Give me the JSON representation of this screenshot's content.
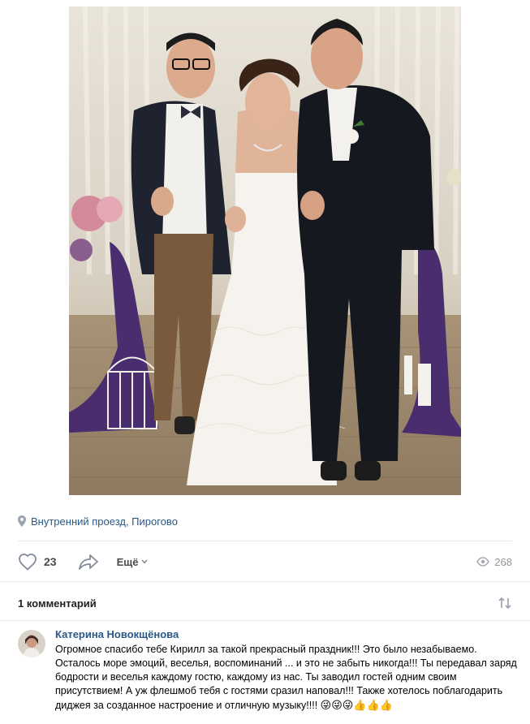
{
  "post": {
    "location": "Внутренний проезд, Пирогово",
    "likes": "23",
    "more_label": "Ещё",
    "views": "268"
  },
  "comments": {
    "title": "1 комментарий",
    "items": [
      {
        "author": "Катерина Новокщёнова",
        "text": "Огромное спасибо тебе Кирилл за такой прекрасный праздник!!! Это было незабываемо. Осталось море эмоций, веселья, воспоминаний ... и это не забыть никогда!!! Ты передавал заряд бодрости и веселья каждому гостю, каждому из нас. Ты заводил гостей одним своим присутствием! А уж флешмоб тебя с гостями сразил наповал!!! Также хотелось поблагодарить диджея за созданное настроение и отличную музыку!!!!",
        "emojis": "😜😜😜👍👍👍"
      }
    ]
  },
  "colors": {
    "link": "#2a5885",
    "muted": "#939393",
    "icon": "#828a99"
  }
}
